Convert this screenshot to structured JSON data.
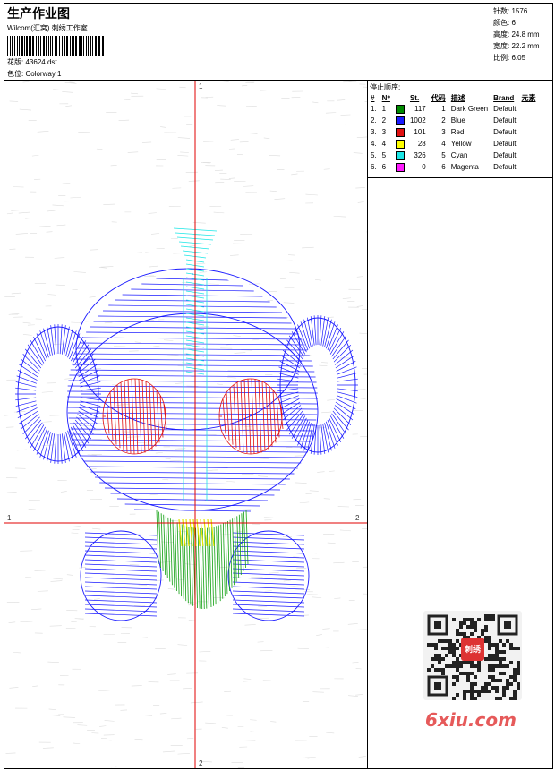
{
  "header": {
    "title": "生产作业图",
    "company": "Wilcom(汇窝) 刺绣工作室",
    "design_label": "花版:",
    "design_file": "43624.dst",
    "colorway_label": "色位:",
    "colorway": "Colorway 1"
  },
  "stats": {
    "stitches_label": "针数:",
    "stitches": "1576",
    "colors_label": "颜色:",
    "colors": "6",
    "height_label": "高度:",
    "height": "24.8 mm",
    "width_label": "宽度:",
    "width": "22.2 mm",
    "ratio_label": "比例:",
    "ratio": "6.05"
  },
  "stop_sequence": {
    "title": "停止顺序:",
    "headers": {
      "n": "#",
      "no": "N⁰",
      "st": "St.",
      "code": "代码",
      "desc": "描述",
      "brand": "Brand",
      "elem": "元素"
    },
    "rows": [
      {
        "n": "1.",
        "no": "1",
        "color": "#008a00",
        "st": "117",
        "code": "1",
        "desc": "Dark Green",
        "brand": "Default"
      },
      {
        "n": "2.",
        "no": "2",
        "color": "#1a1aff",
        "st": "1002",
        "code": "2",
        "desc": "Blue",
        "brand": "Default"
      },
      {
        "n": "3.",
        "no": "3",
        "color": "#e01010",
        "st": "101",
        "code": "3",
        "desc": "Red",
        "brand": "Default"
      },
      {
        "n": "4.",
        "no": "4",
        "color": "#ffff00",
        "st": "28",
        "code": "4",
        "desc": "Yellow",
        "brand": "Default"
      },
      {
        "n": "5.",
        "no": "5",
        "color": "#1ae6e6",
        "st": "326",
        "code": "5",
        "desc": "Cyan",
        "brand": "Default"
      },
      {
        "n": "6.",
        "no": "6",
        "color": "#ff1aff",
        "st": "0",
        "code": "6",
        "desc": "Magenta",
        "brand": "Default"
      }
    ]
  },
  "axes": {
    "top": "1",
    "bottom": "2",
    "left": "1",
    "right": "2",
    "axis_color": "#e00000"
  },
  "watermark": {
    "text": "6xiu.com",
    "badge": "刺绣"
  }
}
